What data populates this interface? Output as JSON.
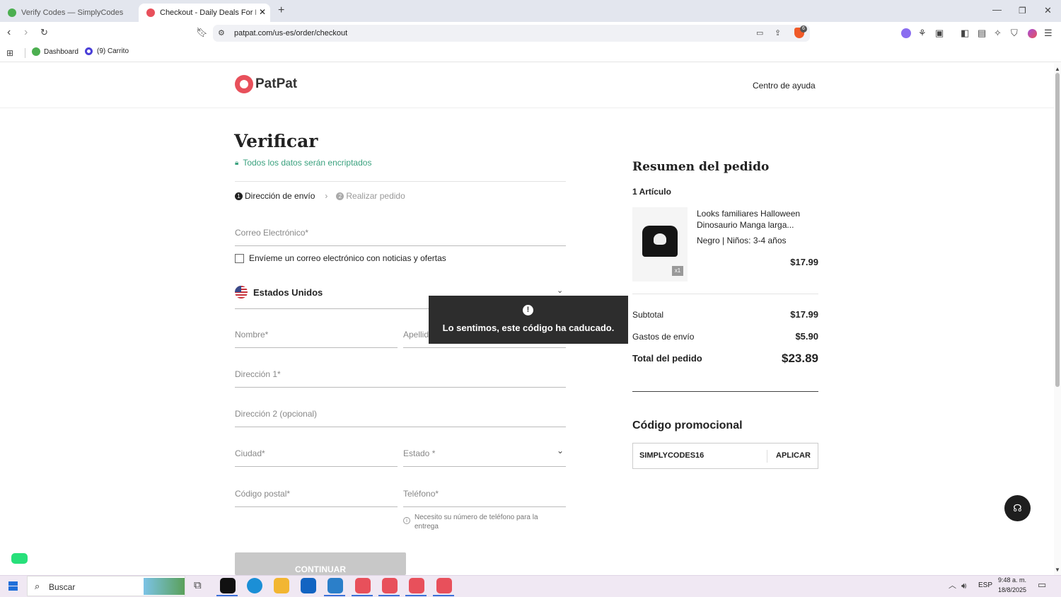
{
  "browser": {
    "tabs": [
      {
        "title": "Verify Codes — SimplyCodes",
        "active": false
      },
      {
        "title": "Checkout - Daily Deals For Mom",
        "active": true
      }
    ],
    "url": "patpat.com/us-es/order/checkout",
    "bookmarks": [
      {
        "label": "Dashboard"
      },
      {
        "label": "(9) Carrito"
      }
    ],
    "shield_count": "6"
  },
  "header": {
    "brand": "PatPat",
    "help_link": "Centro de ayuda"
  },
  "checkout": {
    "title": "Verificar",
    "encrypted_note": "Todos los datos serán encriptados",
    "steps": [
      {
        "num": "1",
        "label": "Dirección de envío",
        "active": true
      },
      {
        "num": "2",
        "label": "Realizar pedido",
        "active": false
      }
    ],
    "email_placeholder": "Correo Electrónico*",
    "newsletter_label": "Envíeme un correo electrónico con noticias y ofertas",
    "country": "Estados Unidos",
    "first_name": "Nombre*",
    "last_name": "Apellido",
    "address1": "Dirección 1*",
    "address2": "Dirección 2 (opcional)",
    "city": "Ciudad*",
    "state": "Estado *",
    "zip": "Código postal*",
    "phone": "Teléfono*",
    "phone_note": "Necesito su número de teléfono para la entrega",
    "continue_label": "CONTINUAR"
  },
  "toast": {
    "icon": "exclamation-icon",
    "message": "Lo sentimos, este código ha caducado."
  },
  "summary": {
    "title": "Resumen del pedido",
    "item_count": "1 Artículo",
    "item": {
      "name": "Looks familiares Halloween Dinosaurio Manga larga...",
      "variant": "Negro | Niños: 3-4 años",
      "price": "$17.99",
      "qty": "x1"
    },
    "subtotal_label": "Subtotal",
    "subtotal": "$17.99",
    "shipping_label": "Gastos de envío",
    "shipping": "$5.90",
    "total_label": "Total del pedido",
    "total": "$23.89",
    "promo_title": "Código promocional",
    "promo_value": "SIMPLYCODES16",
    "apply_label": "APLICAR"
  },
  "taskbar": {
    "search_label": "Buscar",
    "lang": "ESP",
    "time": "9:48 a. m.",
    "date": "18/8/2025"
  },
  "colors": {
    "brand": "#e8505b",
    "green": "#3aa17e",
    "toast_bg": "#2d2d2d",
    "support_bg": "#1e1e1e"
  }
}
